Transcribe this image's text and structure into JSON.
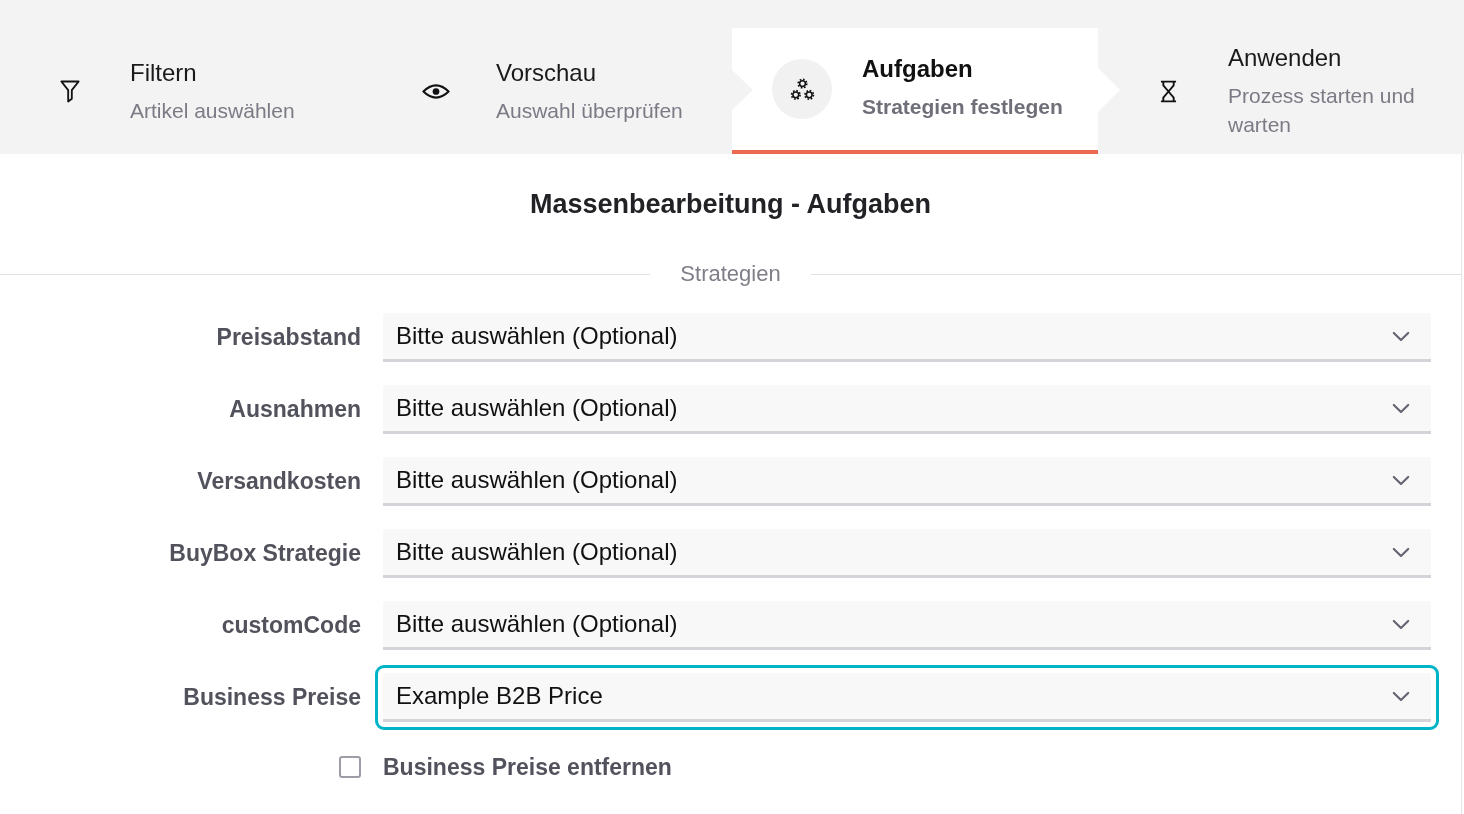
{
  "steps": [
    {
      "title": "Filtern",
      "subtitle": "Artikel auswählen",
      "selected": false
    },
    {
      "title": "Vorschau",
      "subtitle": "Auswahl überprüfen",
      "selected": false
    },
    {
      "title": "Aufgaben",
      "subtitle": "Strategien festlegen",
      "selected": true
    },
    {
      "title": "Anwenden",
      "subtitle": "Prozess starten und warten",
      "selected": false
    }
  ],
  "page_title": "Massenbearbeitung - Aufgaben",
  "strategies": {
    "legend": "Strategien",
    "fields": [
      {
        "label": "Preisabstand",
        "value": "Bitte auswählen (Optional)",
        "focused": false
      },
      {
        "label": "Ausnahmen",
        "value": "Bitte auswählen (Optional)",
        "focused": false
      },
      {
        "label": "Versandkosten",
        "value": "Bitte auswählen (Optional)",
        "focused": false
      },
      {
        "label": "BuyBox Strategie",
        "value": "Bitte auswählen (Optional)",
        "focused": false
      },
      {
        "label": "customCode",
        "value": "Bitte auswählen (Optional)",
        "focused": false
      },
      {
        "label": "Business Preise",
        "value": "Example B2B Price",
        "focused": true
      }
    ],
    "remove_business_prices": {
      "label": "Business Preise entfernen",
      "checked": false
    }
  }
}
